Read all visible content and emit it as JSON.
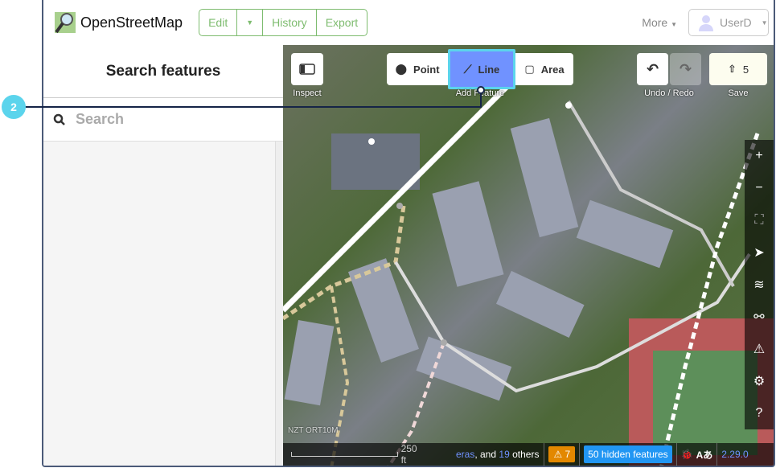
{
  "header": {
    "logo": "OpenStreetMap",
    "edit": "Edit",
    "history": "History",
    "export": "Export",
    "more": "More",
    "user": "UserD"
  },
  "sidebar": {
    "title": "Search features",
    "search_placeholder": "Search"
  },
  "toolbar": {
    "inspect": "Inspect",
    "point": "Point",
    "line": "Line",
    "area": "Area",
    "add_feature": "Add Feature",
    "undo_redo": "Undo / Redo",
    "save": "Save",
    "save_count": "5"
  },
  "footer": {
    "scale": "250 ft",
    "attribution_link": "eras",
    "attribution_and": ", and",
    "others_count": "19",
    "attribution_others": "others",
    "issues": "7",
    "hidden": "50 hidden features",
    "version": "2.29.0",
    "imagery": "NZT ORT10M"
  },
  "annotation": {
    "number": "2",
    "color": "#5bd4ec"
  },
  "colors": {
    "brand": "#7ebc6f",
    "active_tool": "#7092ff",
    "issues": "#e38800",
    "hidden": "#2196f3"
  }
}
